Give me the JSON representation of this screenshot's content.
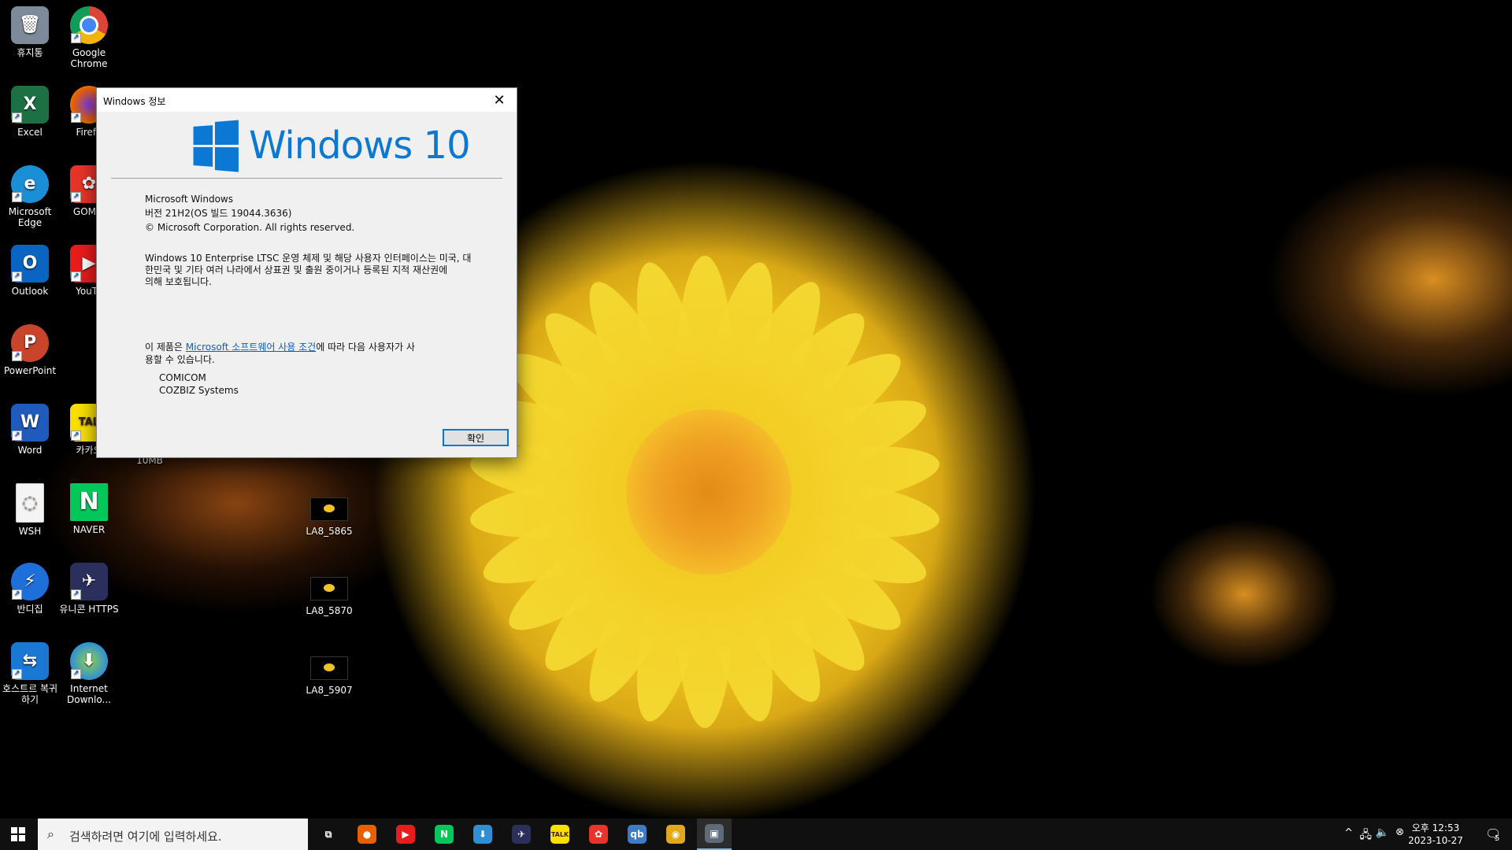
{
  "desktop": {
    "icons": [
      {
        "label": "휴지통",
        "color": "#7d8a99",
        "glyph": "🗑"
      },
      {
        "label": "Google Chrome",
        "color": "#f1f1f1",
        "glyph": "◉"
      },
      {
        "label": "Excel",
        "color": "#1d7044",
        "glyph": "X"
      },
      {
        "label": "Firefo",
        "color": "#e66000",
        "glyph": "●"
      },
      {
        "label": "Microsoft Edge",
        "color": "#1a8fd6",
        "glyph": "e"
      },
      {
        "label": "GOM P",
        "color": "#e8342a",
        "glyph": "✿"
      },
      {
        "label": "Outlook",
        "color": "#0a64c1",
        "glyph": "O"
      },
      {
        "label": "YouTu",
        "color": "#e91c1c",
        "glyph": "▶"
      },
      {
        "label": "PowerPoint",
        "color": "#c8452c",
        "glyph": "P"
      },
      {
        "label": "Word",
        "color": "#1e5bbc",
        "glyph": "W"
      },
      {
        "label": "카카오",
        "color": "#f9e000",
        "glyph": "TAL"
      },
      {
        "label": "WSH",
        "color": "#f4f4f4",
        "glyph": "◌"
      },
      {
        "label": "NAVER",
        "color": "#03c75a",
        "glyph": "N"
      },
      {
        "label": "반디집",
        "color": "#1e6fd9",
        "glyph": "⚡"
      },
      {
        "label": "유니콘 HTTPS",
        "color": "#2a2f5c",
        "glyph": "✈"
      },
      {
        "label": "호스트르 복귀하기",
        "color": "#1978d4",
        "glyph": "⇆"
      },
      {
        "label": "Internet Downlo...",
        "color": "#2f8fd5",
        "glyph": "⬇"
      }
    ],
    "files": [
      {
        "label": "LA8_5865"
      },
      {
        "label": "LA8_5870"
      },
      {
        "label": "LA8_5907"
      }
    ],
    "partial_label": "10MB"
  },
  "dialog": {
    "title": "Windows 정보",
    "logo_text": "Windows 10",
    "product": "Microsoft Windows",
    "version": "버전 21H2(OS 빌드 19044.3636)",
    "copyright": "© Microsoft Corporation. All rights reserved.",
    "legal_line1": "Windows 10 Enterprise LTSC 운영 체제 및 해당 사용자 인터페이스는 미국, 대",
    "legal_line2": "한민국 및 기타 여러 나라에서 상표권 및 출원 중이거나 등록된 지적 재산권에",
    "legal_line3": "의해 보호됩니다.",
    "license_prefix": "이 제품은 ",
    "license_link": "Microsoft 소프트웨어 사용 조건",
    "license_suffix1": "에 따라 다음 사용자가 사",
    "license_suffix2": "용할 수 있습니다.",
    "user1": "COMICOM",
    "user2": "COZBIZ Systems",
    "ok_label": "확인"
  },
  "taskbar": {
    "search_placeholder": "검색하려면 여기에 입력하세요.",
    "apps": [
      {
        "name": "task-view",
        "glyph": "⧉",
        "color": "#101010"
      },
      {
        "name": "firefox",
        "glyph": "●",
        "color": "#e66000"
      },
      {
        "name": "youtube",
        "glyph": "▶",
        "color": "#e91c1c"
      },
      {
        "name": "naver",
        "glyph": "N",
        "color": "#03c75a"
      },
      {
        "name": "internet-download-manager",
        "glyph": "⬇",
        "color": "#2f8fd5"
      },
      {
        "name": "unicorn-https",
        "glyph": "✈",
        "color": "#2a2f5c"
      },
      {
        "name": "kakaotalk",
        "glyph": "TALK",
        "color": "#f9e000"
      },
      {
        "name": "gom-player",
        "glyph": "✿",
        "color": "#e8342a"
      },
      {
        "name": "qbittorrent",
        "glyph": "qb",
        "color": "#3d7bc7"
      },
      {
        "name": "chrome",
        "glyph": "◉",
        "color": "#e2a71b"
      },
      {
        "name": "windows-info",
        "glyph": "▣",
        "color": "#5f6b78"
      }
    ],
    "clock_time": "오후 12:53",
    "clock_date": "2023-10-27",
    "notification_count": "5"
  }
}
